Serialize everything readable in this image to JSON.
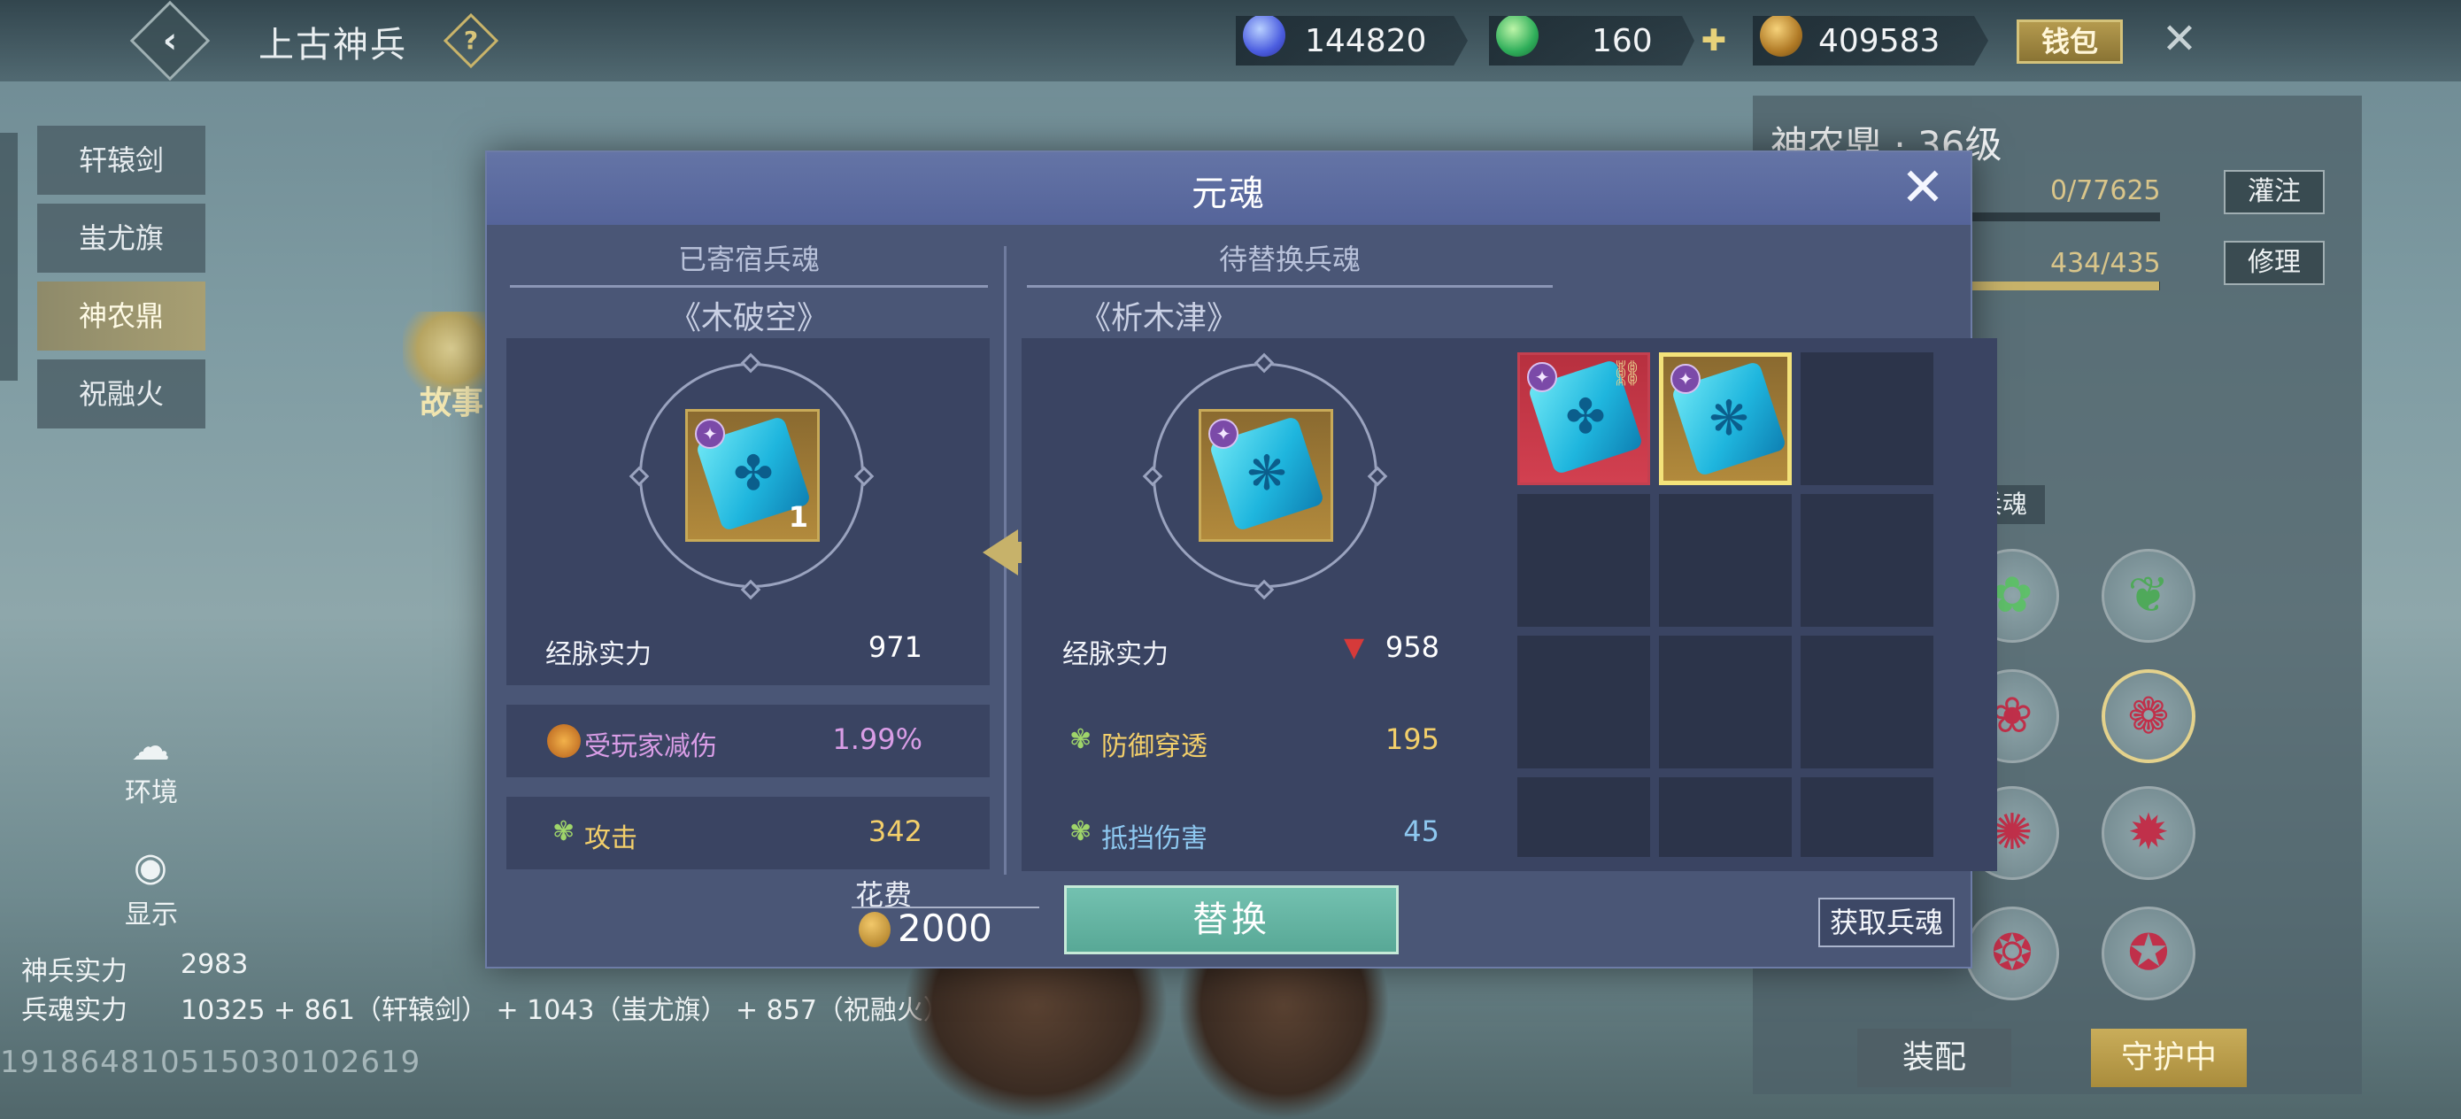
{
  "header": {
    "title": "上古神兵",
    "currencies": [
      {
        "icon": "blue-gem-icon",
        "value": "144820"
      },
      {
        "icon": "jade-coin-icon",
        "value": "160"
      },
      {
        "icon": "gold-coin-icon",
        "value": "409583"
      }
    ],
    "wallet_label": "钱包"
  },
  "sidebar": {
    "items": [
      {
        "label": "轩辕剑",
        "active": false
      },
      {
        "label": "蚩尤旗",
        "active": false
      },
      {
        "label": "神农鼎",
        "active": true
      },
      {
        "label": "祝融火",
        "active": false
      }
    ],
    "story_label": "故事",
    "environment_label": "环境",
    "display_label": "显示"
  },
  "power": {
    "weapon_label": "神兵实力",
    "weapon_value": "2983",
    "soul_label": "兵魂实力",
    "soul_value": "10325 + 861（轩辕剑） + 1043（蚩尤旗） + 857（祝融火）"
  },
  "uid": "19186481051503010261​9",
  "right_panel": {
    "title": "神农鼎 · 36级",
    "bar1_text": "0/77625",
    "bar1_fraction": 0.0,
    "bar1_button": "灌注",
    "bar2_text": "434/435",
    "bar2_fraction": 0.998,
    "bar2_button": "修理",
    "soul_tag": "兵魂",
    "equip_label": "装配",
    "guard_label": "守护中"
  },
  "modal": {
    "title": "元魂",
    "left": {
      "header": "已寄宿兵魂",
      "soul_name": "《木破空》",
      "item_count": "1",
      "stats": [
        {
          "label": "经脉实力",
          "value": "971",
          "color": "#ffffff",
          "icon": ""
        },
        {
          "label": "受玩家减伤",
          "value": "1.99%",
          "color": "#d99de6",
          "icon": "spiral-icon"
        },
        {
          "label": "攻击",
          "value": "342",
          "color": "#f3cf6a",
          "icon": "leaf-icon"
        }
      ]
    },
    "right": {
      "header": "待替换兵魂",
      "soul_name": "《析木津》",
      "stats": [
        {
          "label": "经脉实力",
          "value": "958",
          "color": "#ffffff",
          "icon": "down-arrow-icon"
        },
        {
          "label": "防御穿透",
          "value": "195",
          "color": "#f3cf6a",
          "icon": "leaf-icon"
        },
        {
          "label": "抵挡伤害",
          "value": "45",
          "color": "#8ec8f0",
          "icon": "leaf-icon"
        }
      ]
    },
    "cost_label": "花费",
    "cost_value": "2000",
    "replace_label": "替换",
    "get_soul_label": "获取兵魂"
  }
}
